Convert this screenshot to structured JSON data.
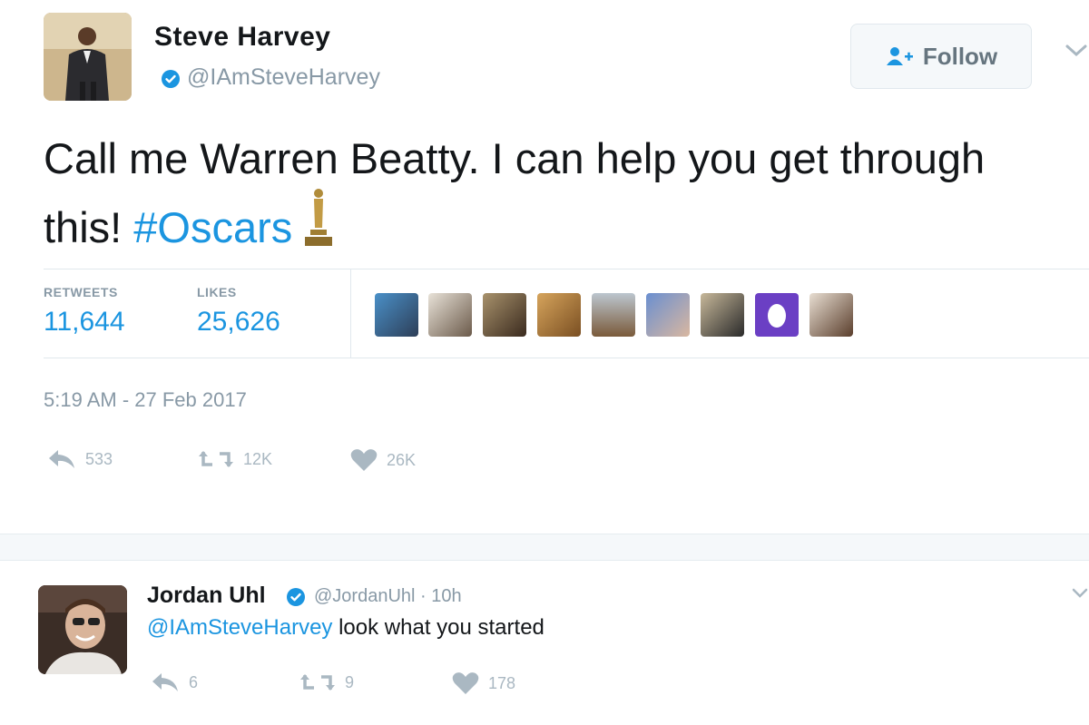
{
  "tweet": {
    "author": {
      "name": "Steve Harvey",
      "handle": "@IAmSteveHarvey"
    },
    "follow_label": "Follow",
    "text_before": "Call me Warren Beatty. I can help you get through this! ",
    "hashtag": "#Oscars",
    "stats": {
      "retweets_label": "RETWEETS",
      "retweets_value": "11,644",
      "likes_label": "LIKES",
      "likes_value": "25,626"
    },
    "liker_count": 9,
    "timestamp": "5:19 AM - 27 Feb 2017",
    "actions": {
      "reply_count": "533",
      "retweet_count": "12K",
      "like_count": "26K"
    }
  },
  "reply": {
    "author": {
      "name": "Jordan Uhl",
      "handle_and_time": "@JordanUhl · 10h"
    },
    "mention": "@IAmSteveHarvey",
    "text": " look what you started",
    "actions": {
      "reply_count": "6",
      "retweet_count": "9",
      "like_count": "178"
    }
  },
  "colors": {
    "accent": "#1b95e0",
    "muted": "#8899a6",
    "icon": "#aab8c2",
    "text": "#14171a"
  }
}
